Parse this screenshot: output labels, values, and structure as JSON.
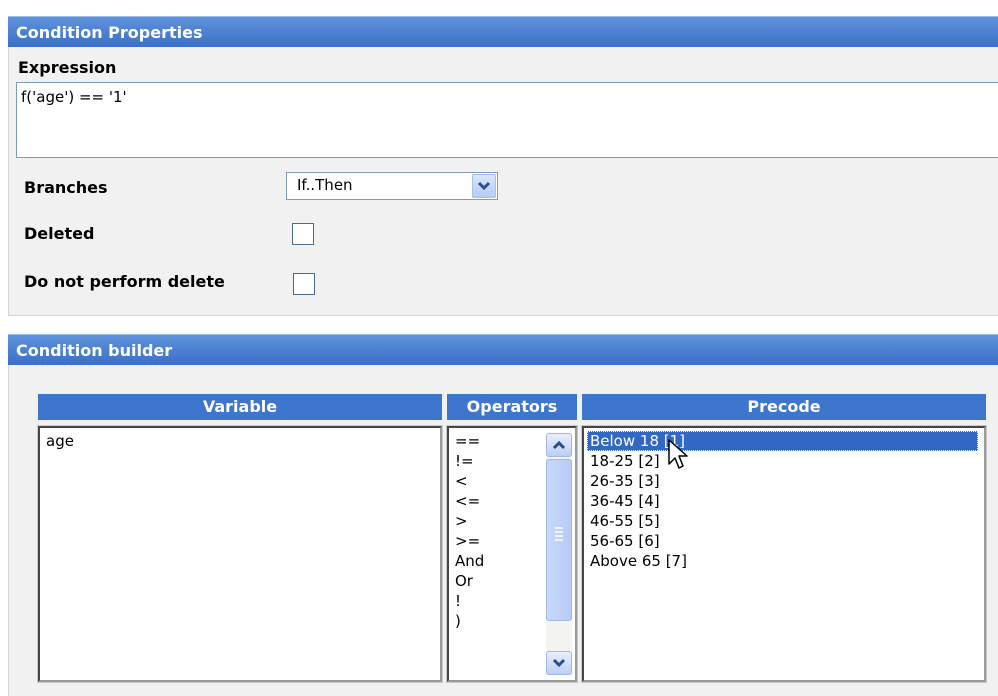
{
  "condition_properties": {
    "title": "Condition Properties",
    "expression_label": "Expression",
    "expression_value": "f('age') == '1'",
    "branches_label": "Branches",
    "branches_value": "If..Then",
    "deleted_label": "Deleted",
    "deleted_checked": false,
    "no_delete_label": "Do not perform delete",
    "no_delete_checked": false
  },
  "condition_builder": {
    "title": "Condition builder",
    "variable_header": "Variable",
    "operators_header": "Operators",
    "precode_header": "Precode",
    "variables": [
      "age"
    ],
    "operators": [
      "==",
      "!=",
      "<",
      "<=",
      ">",
      ">=",
      "And",
      "Or",
      "!",
      ")"
    ],
    "precodes": [
      "Below 18 [1]",
      "18-25 [2]",
      "26-35 [3]",
      "36-45 [4]",
      "46-55 [5]",
      "56-65 [6]",
      "Above 65 [7]"
    ],
    "selected_precode_index": 0
  },
  "icons": {
    "dropdown": "chevron-down-icon",
    "scroll_up": "chevron-up-icon",
    "scroll_down": "chevron-down-icon",
    "scroll_grip": "grip-icon",
    "cursor": "mouse-pointer-icon"
  },
  "colors": {
    "header_bg": "#3a6fc7",
    "selection_bg": "#3167c5",
    "panel_bg": "#f1f1f1"
  }
}
